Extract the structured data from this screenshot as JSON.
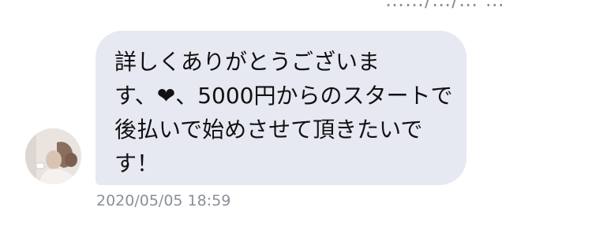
{
  "top_text": "……/…/… …",
  "avatar": {
    "icon": "person-photo-icon"
  },
  "message": {
    "line1": "詳しくありがとうございま",
    "line2_pre": "す、",
    "line2_heart": "❤",
    "line2_post": "、5000円からのスタートで",
    "line3": "後払いで始めさせて頂きたいで",
    "line4": "す！"
  },
  "timestamp": "2020/05/05 18:59",
  "colors": {
    "bubble": "#e6e9f2",
    "text": "#111111",
    "timestamp": "#8a8f98"
  }
}
